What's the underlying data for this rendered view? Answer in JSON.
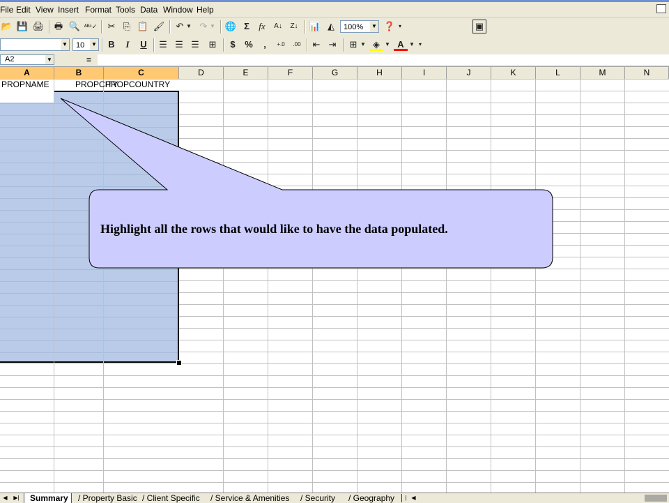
{
  "menu": [
    "File",
    "Edit",
    "View",
    "Insert",
    "Format",
    "Tools",
    "Data",
    "Window",
    "Help"
  ],
  "toolbar": {
    "zoom": "100%",
    "font_size": "10",
    "bold": "B",
    "italic": "I",
    "underline": "U",
    "currency": "$",
    "percent": "%",
    "comma": ",",
    "sigma": "Σ",
    "fx": "fx"
  },
  "formula_bar": {
    "name_box": "A2",
    "equals": "=",
    "formula": ""
  },
  "columns": [
    "A",
    "B",
    "C",
    "D",
    "E",
    "F",
    "G",
    "H",
    "I",
    "J",
    "K",
    "L",
    "M",
    "N"
  ],
  "headers": {
    "a1": "PROPNAME",
    "b1": "PROPCITY",
    "c1": "PROPCOUNTRY"
  },
  "callout": {
    "text": "Highlight all the rows that would like to have the data populated.",
    "fill": "#ccccff",
    "stroke": "#000000"
  },
  "sheet_tabs": [
    "Summary",
    "Property Basic",
    "Client Specific",
    "Service & Amenities",
    "Security",
    "Geography"
  ],
  "active_tab": "Summary",
  "colors": {
    "selection": "#b9cbe8",
    "chrome": "#ece9d8"
  }
}
